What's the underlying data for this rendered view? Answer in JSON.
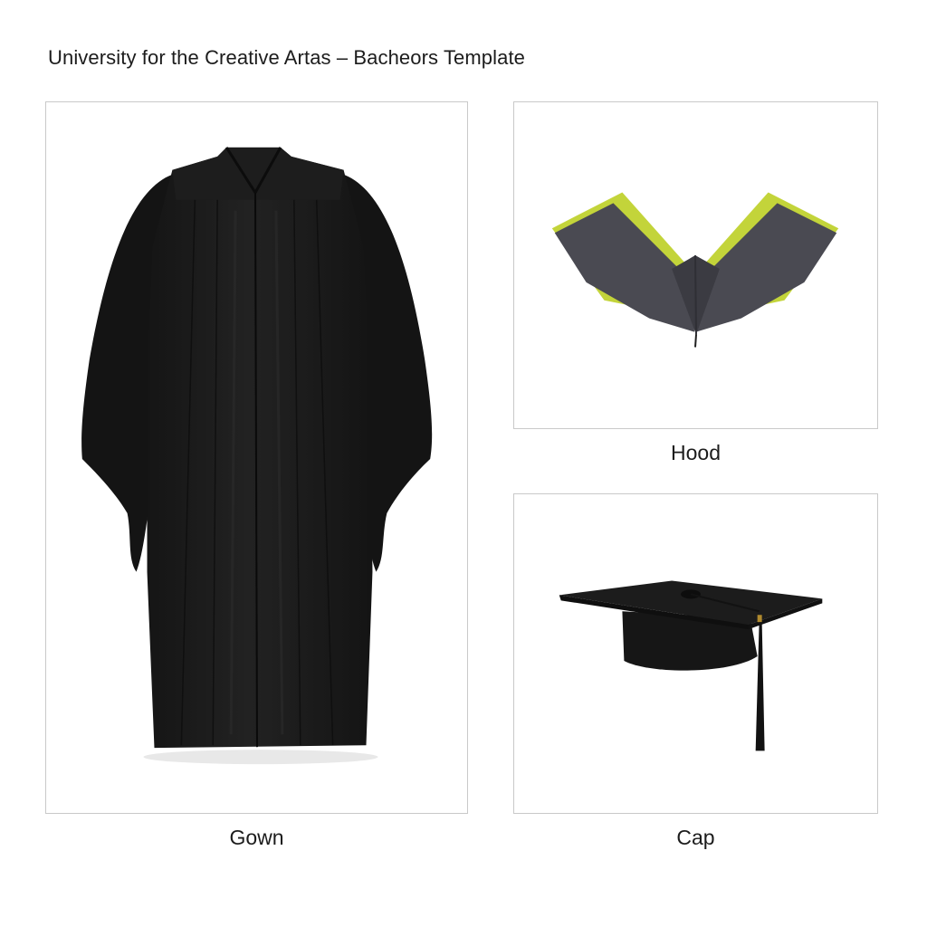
{
  "page": {
    "title": "University for the Creative Artas – Bacheors Template"
  },
  "items": {
    "gown": {
      "caption": "Gown",
      "icon": "gown-icon",
      "colors": {
        "fabric": "#1b1b1b",
        "shadow": "#0e0e0e",
        "highlight": "#2e2e2e"
      }
    },
    "hood": {
      "caption": "Hood",
      "icon": "hood-icon",
      "colors": {
        "outer": "#4a4a52",
        "lining": "#c3d43a",
        "shadow": "#2f2f35"
      }
    },
    "cap": {
      "caption": "Cap",
      "icon": "mortarboard-icon",
      "colors": {
        "board": "#1c1c1c",
        "skull": "#161616",
        "tassel": "#121212",
        "button": "#0d0d0d",
        "ring": "#b08a2e"
      }
    }
  }
}
